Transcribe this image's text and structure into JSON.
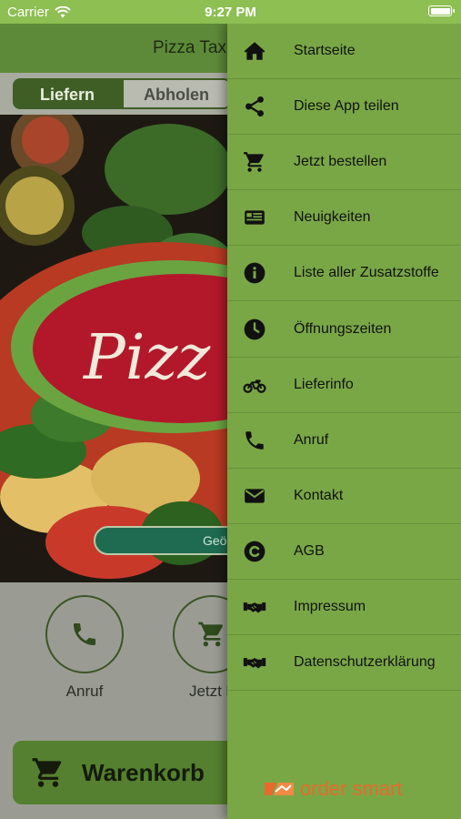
{
  "status": {
    "carrier": "Carrier",
    "time": "9:27 PM"
  },
  "app": {
    "title": "Pizza Tax",
    "tabs": [
      {
        "label": "Liefern",
        "active": true
      },
      {
        "label": "Abholen",
        "active": false
      }
    ],
    "hero_button": "Geö",
    "quick": [
      {
        "label": "Anruf",
        "icon": "phone-icon"
      },
      {
        "label": "Jetzt b",
        "icon": "cart-icon"
      }
    ],
    "cart_label": "Warenkorb"
  },
  "drawer": {
    "items": [
      {
        "label": "Startseite",
        "icon": "home-icon"
      },
      {
        "label": "Diese App teilen",
        "icon": "share-icon"
      },
      {
        "label": "Jetzt bestellen",
        "icon": "cart-icon"
      },
      {
        "label": "Neuigkeiten",
        "icon": "newspaper-icon"
      },
      {
        "label": "Liste aller Zusatzstoffe",
        "icon": "info-icon"
      },
      {
        "label": "Öffnungszeiten",
        "icon": "clock-icon"
      },
      {
        "label": "Lieferinfo",
        "icon": "motorcycle-icon"
      },
      {
        "label": "Anruf",
        "icon": "phone-icon"
      },
      {
        "label": "Kontakt",
        "icon": "envelope-icon"
      },
      {
        "label": "AGB",
        "icon": "copyright-icon"
      },
      {
        "label": "Impressum",
        "icon": "handshake-icon"
      },
      {
        "label": "Datenschutzerklärung",
        "icon": "handshake-icon"
      }
    ],
    "brand": "order smart"
  },
  "colors": {
    "accent": "#7aa746",
    "status_bar": "#8dbf52",
    "brand": "#e86a2c"
  }
}
